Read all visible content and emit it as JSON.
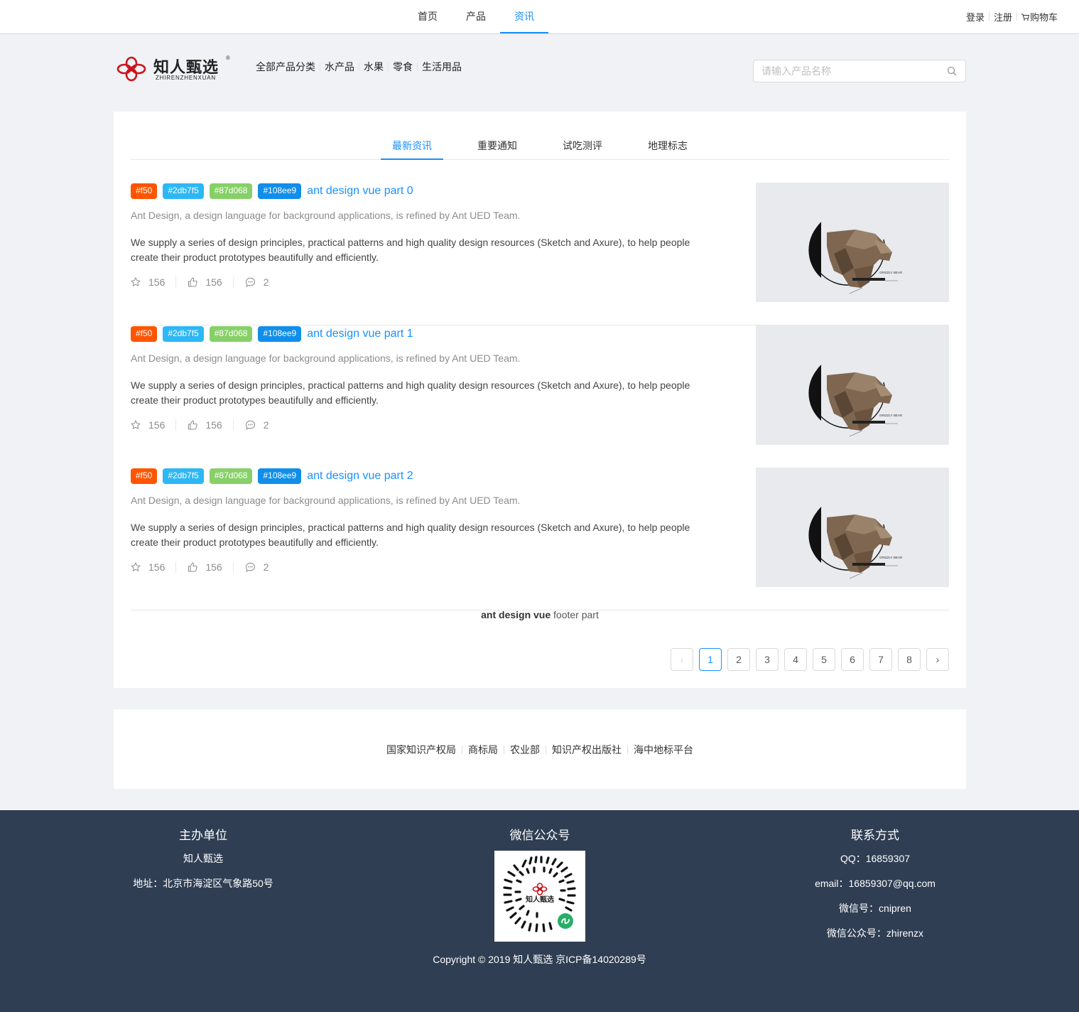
{
  "top_nav": {
    "items": [
      "首页",
      "产品",
      "资讯"
    ],
    "active": "资讯"
  },
  "top_links": {
    "login": "登录",
    "register": "注册",
    "cart": "购物车"
  },
  "brand": {
    "name_cn": "知人甄选",
    "name_en": "ZHIRENZHENXUAN",
    "reg_mark": "®"
  },
  "category_nav": [
    "全部产品分类",
    "水产品",
    "水果",
    "零食",
    "生活用品"
  ],
  "search": {
    "placeholder": "请输入产品名称",
    "value": ""
  },
  "tabs": [
    "最新资讯",
    "重要通知",
    "试吃测评",
    "地理标志"
  ],
  "active_tab": "最新资讯",
  "tag_colors": {
    "#f50": "#ff5500",
    "#2db7f5": "#2db7f5",
    "#87d068": "#87d068",
    "#108ee9": "#108ee9"
  },
  "articles": [
    {
      "tags": [
        "#f50",
        "#2db7f5",
        "#87d068",
        "#108ee9"
      ],
      "title": "ant design vue part 0",
      "description": "Ant Design, a design language for background applications, is refined by Ant UED Team.",
      "content": "We supply a series of design principles, practical patterns and high quality design resources (Sketch and Axure), to help people create their product prototypes beautifully and efficiently.",
      "stars": "156",
      "likes": "156",
      "comments": "2",
      "image_text": "GRIZZLY BEAR"
    },
    {
      "tags": [
        "#f50",
        "#2db7f5",
        "#87d068",
        "#108ee9"
      ],
      "title": "ant design vue part 1",
      "description": "Ant Design, a design language for background applications, is refined by Ant UED Team.",
      "content": "We supply a series of design principles, practical patterns and high quality design resources (Sketch and Axure), to help people create their product prototypes beautifully and efficiently.",
      "stars": "156",
      "likes": "156",
      "comments": "2",
      "image_text": "GRIZZLY BEAR"
    },
    {
      "tags": [
        "#f50",
        "#2db7f5",
        "#87d068",
        "#108ee9"
      ],
      "title": "ant design vue part 2",
      "description": "Ant Design, a design language for background applications, is refined by Ant UED Team.",
      "content": "We supply a series of design principles, practical patterns and high quality design resources (Sketch and Axure), to help people create their product prototypes beautifully and efficiently.",
      "stars": "156",
      "likes": "156",
      "comments": "2",
      "image_text": "GRIZZLY BEAR"
    }
  ],
  "list_footer": {
    "bold": "ant design vue",
    "rest": " footer part"
  },
  "pagination": {
    "pages": [
      "1",
      "2",
      "3",
      "4",
      "5",
      "6",
      "7",
      "8"
    ],
    "current": "1",
    "prev": "‹",
    "next": "›"
  },
  "friend_links": [
    "国家知识产权局",
    "商标局",
    "农业部",
    "知识产权出版社",
    "海中地标平台"
  ],
  "footer": {
    "organizer": {
      "heading": "主办单位",
      "name": "知人甄选",
      "address": "地址：北京市海淀区气象路50号"
    },
    "wechat": {
      "heading": "微信公众号",
      "qr_text": "知人甄选"
    },
    "contact": {
      "heading": "联系方式",
      "qq": "QQ：16859307",
      "email": "email：16859307@qq.com",
      "wechat_id": "微信号：cnipren",
      "wechat_public": "微信公众号：zhirenzx"
    },
    "copyright": "Copyright © 2019 知人甄选 京ICP备14020289号"
  },
  "colors": {
    "accent": "#1890ff",
    "footer_bg": "#2f3e53",
    "page_bg": "#f0f2f5"
  }
}
